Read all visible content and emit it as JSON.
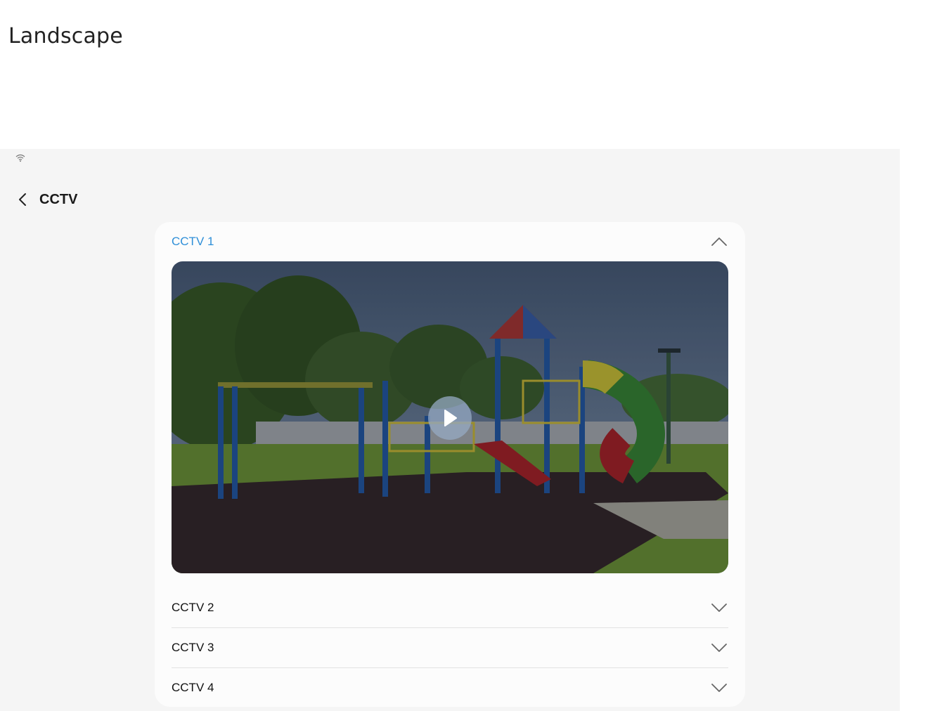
{
  "document_title": "Landscape",
  "header": {
    "title": "CCTV"
  },
  "icons": {
    "status": "wifi-icon",
    "back": "chevron-left-icon",
    "expanded": "chevron-up-icon",
    "collapsed": "chevron-down-icon",
    "play": "play-icon"
  },
  "colors": {
    "accent": "#2f8fd8",
    "background": "#f5f5f5",
    "card": "#fcfcfc"
  },
  "cctv_list": [
    {
      "label": "CCTV 1",
      "expanded": true
    },
    {
      "label": "CCTV 2",
      "expanded": false
    },
    {
      "label": "CCTV 3",
      "expanded": false
    },
    {
      "label": "CCTV 4",
      "expanded": false
    }
  ]
}
